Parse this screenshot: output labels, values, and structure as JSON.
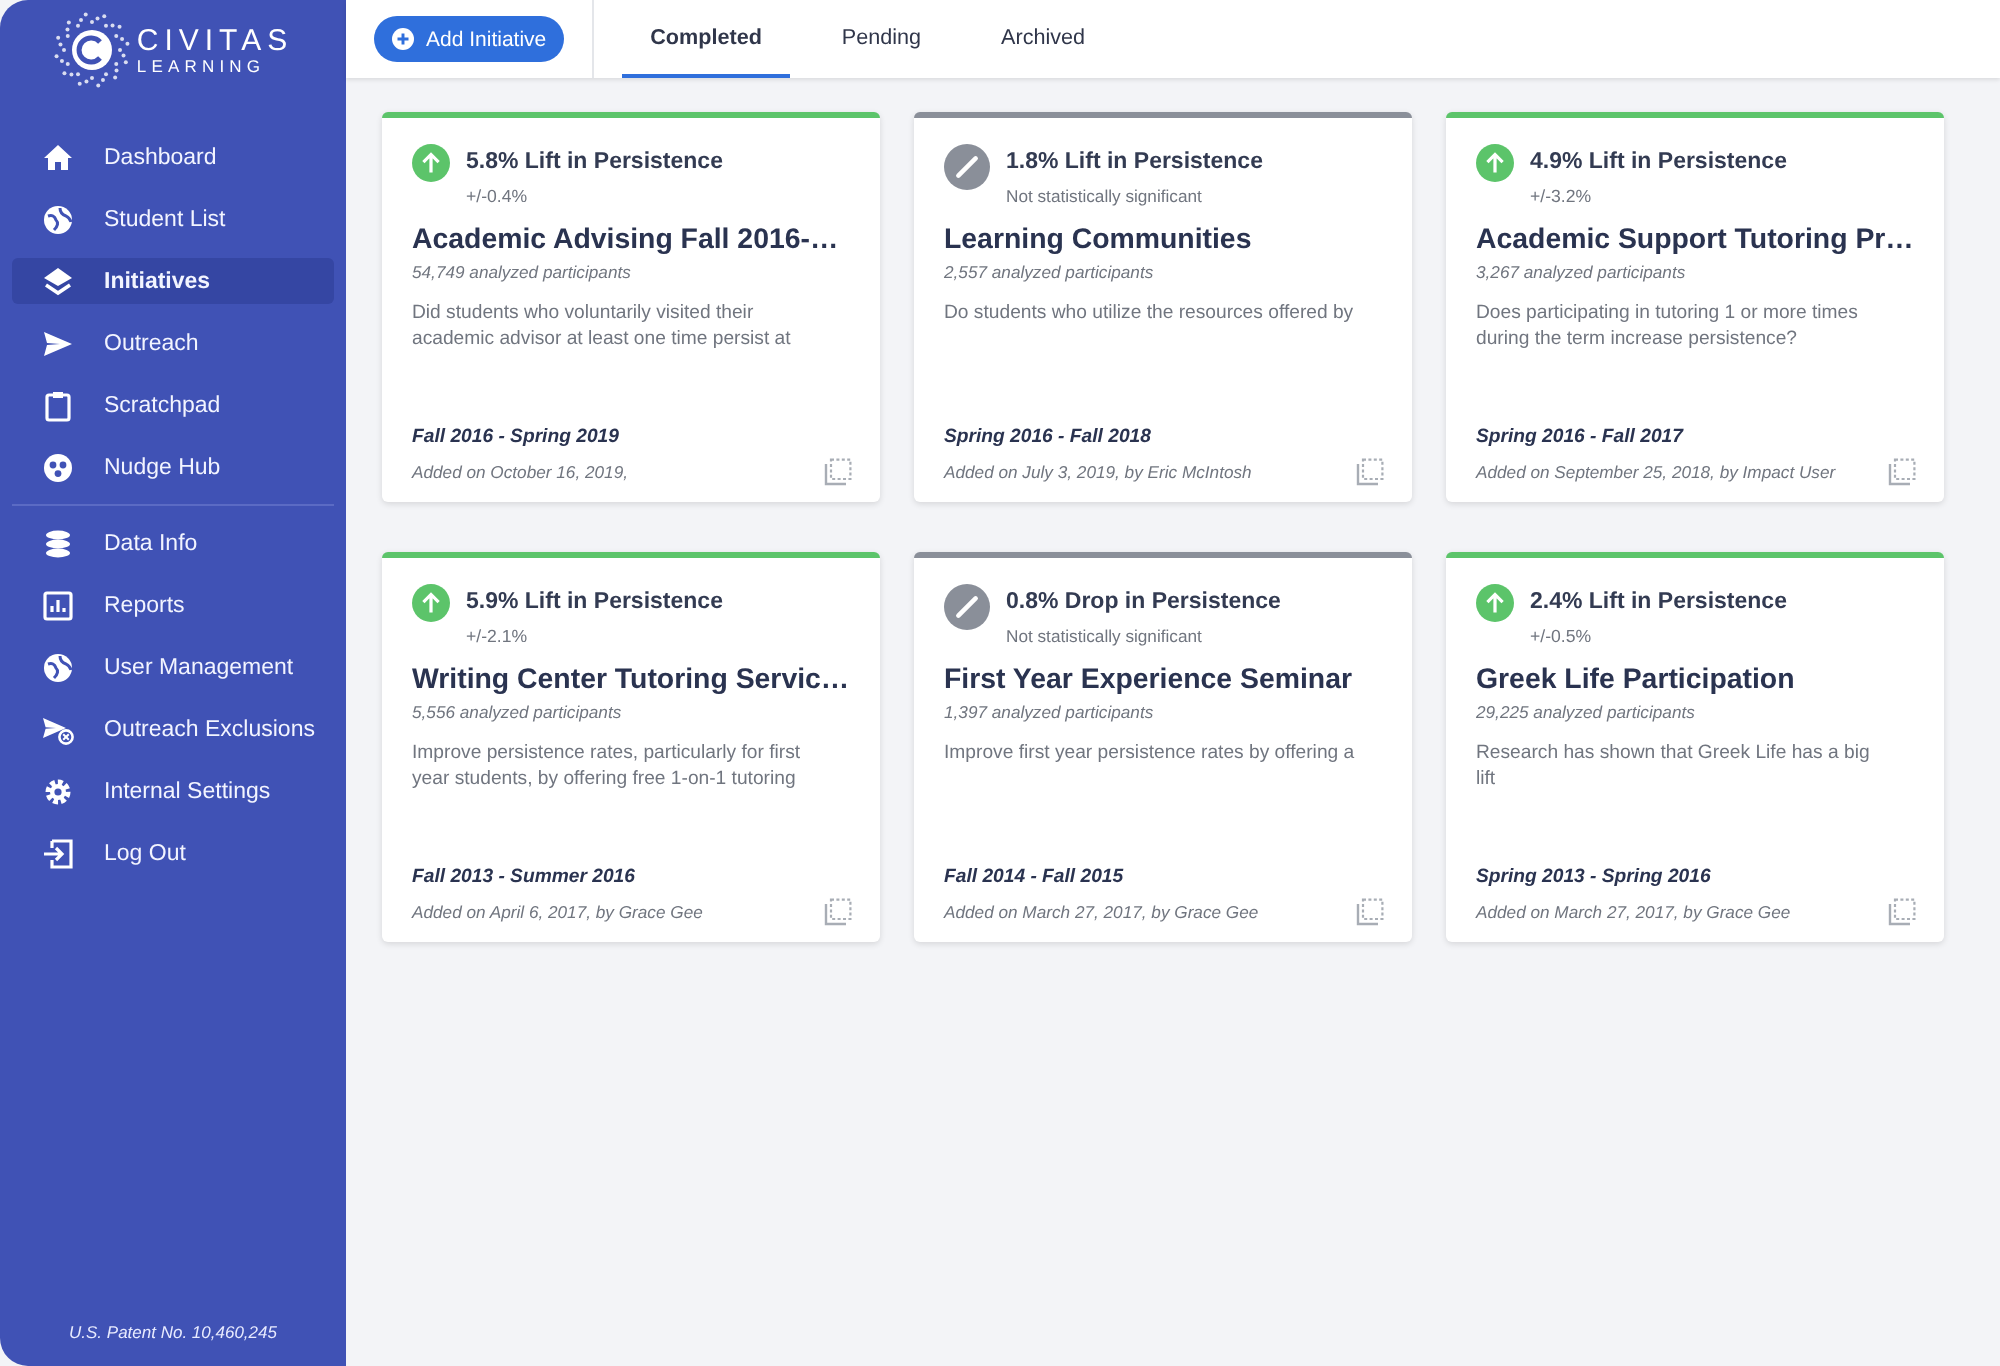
{
  "sidebar": {
    "logo": {
      "line_1": "CIVITAS",
      "line_2": "LEARNING"
    },
    "groups": [
      [
        {
          "label": "Dashboard",
          "selected": false
        },
        {
          "label": "Student List",
          "selected": false
        },
        {
          "label": "Initiatives",
          "selected": true
        },
        {
          "label": "Outreach",
          "selected": false
        },
        {
          "label": "Scratchpad",
          "selected": false
        },
        {
          "label": "Nudge Hub",
          "selected": false
        }
      ],
      [
        {
          "label": "Data Info",
          "selected": false
        },
        {
          "label": "Reports",
          "selected": false
        },
        {
          "label": "User Management",
          "selected": false
        },
        {
          "label": "Outreach Exclusions",
          "selected": false
        },
        {
          "label": "Internal Settings",
          "selected": false
        },
        {
          "label": "Log Out",
          "selected": false
        }
      ]
    ],
    "footer": "U.S. Patent No. 10,460,245"
  },
  "toolbar": {
    "add_button": "Add Initiative",
    "tabs": [
      {
        "label": "Completed",
        "selected": true
      },
      {
        "label": "Pending",
        "selected": false
      },
      {
        "label": "Archived",
        "selected": false
      }
    ]
  },
  "cards": [
    {
      "kind": "lift",
      "result": "5.8% Lift in Persistence",
      "detail": "+/-0.4%",
      "title": "Academic Advising Fall 2016-…",
      "participants": "54,749 analyzed participants",
      "description": "Did students who voluntarily visited their academic advisor at least one time persist at",
      "terms": "Fall 2016 - Spring 2019",
      "added": "Added on October 16, 2019,"
    },
    {
      "kind": "insignificant",
      "result": "1.8% Lift in Persistence",
      "detail": "Not statistically significant",
      "title": "Learning Communities",
      "participants": "2,557 analyzed participants",
      "description": "Do students who utilize the resources offered by",
      "terms": "Spring 2016 - Fall 2018",
      "added": "Added on July 3, 2019, by Eric McIntosh"
    },
    {
      "kind": "lift",
      "result": "4.9% Lift in Persistence",
      "detail": "+/-3.2%",
      "title": "Academic Support Tutoring Pr…",
      "participants": "3,267 analyzed participants",
      "description": "Does participating in tutoring 1 or more times during the term increase persistence?",
      "terms": "Spring 2016 - Fall 2017",
      "added": "Added on September 25, 2018, by Impact User"
    },
    {
      "kind": "lift",
      "result": "5.9% Lift in Persistence",
      "detail": "+/-2.1%",
      "title": "Writing Center Tutoring Servic…",
      "participants": "5,556 analyzed participants",
      "description": "Improve persistence rates, particularly for first year students, by offering free 1-on-1 tutoring",
      "terms": "Fall 2013 - Summer 2016",
      "added": "Added on April 6, 2017, by Grace Gee"
    },
    {
      "kind": "insignificant",
      "result": "0.8% Drop in Persistence",
      "detail": "Not statistically significant",
      "title": "First Year Experience Seminar",
      "participants": "1,397 analyzed participants",
      "description": "Improve first year persistence rates by offering a",
      "terms": "Fall 2014 - Fall 2015",
      "added": "Added on March 27, 2017, by Grace Gee"
    },
    {
      "kind": "lift",
      "result": "2.4% Lift in Persistence",
      "detail": "+/-0.5%",
      "title": "Greek Life Participation",
      "participants": "29,225 analyzed participants",
      "description": "Research has shown that Greek Life has a big lift",
      "terms": "Spring 2013 - Spring 2016",
      "added": "Added on March 27, 2017, by Grace Gee"
    }
  ]
}
